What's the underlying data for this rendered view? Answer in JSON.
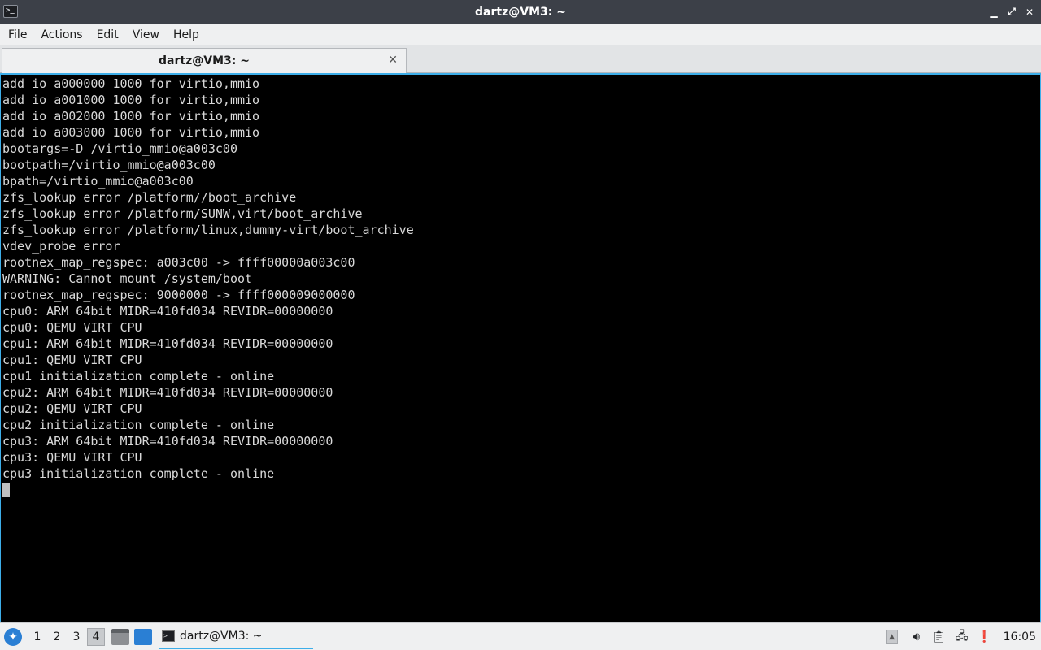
{
  "window": {
    "title": "dartz@VM3: ~",
    "app_icon": ">_",
    "controls": {
      "minimize": "▁",
      "maximize": "⤢",
      "close": "✕"
    }
  },
  "menu": {
    "items": [
      "File",
      "Actions",
      "Edit",
      "View",
      "Help"
    ]
  },
  "tabs": [
    {
      "label": "dartz@VM3: ~",
      "close": "✕"
    }
  ],
  "terminal": {
    "lines": [
      "add io a000000 1000 for virtio,mmio",
      "add io a001000 1000 for virtio,mmio",
      "add io a002000 1000 for virtio,mmio",
      "add io a003000 1000 for virtio,mmio",
      "bootargs=-D /virtio_mmio@a003c00",
      "bootpath=/virtio_mmio@a003c00",
      "bpath=/virtio_mmio@a003c00",
      "zfs_lookup error /platform//boot_archive",
      "zfs_lookup error /platform/SUNW,virt/boot_archive",
      "zfs_lookup error /platform/linux,dummy-virt/boot_archive",
      "vdev_probe error",
      "rootnex_map_regspec: a003c00 -> ffff00000a003c00",
      "WARNING: Cannot mount /system/boot",
      "rootnex_map_regspec: 9000000 -> ffff000009000000",
      "cpu0: ARM 64bit MIDR=410fd034 REVIDR=00000000",
      "cpu0: QEMU VIRT CPU",
      "cpu1: ARM 64bit MIDR=410fd034 REVIDR=00000000",
      "cpu1: QEMU VIRT CPU",
      "cpu1 initialization complete - online",
      "cpu2: ARM 64bit MIDR=410fd034 REVIDR=00000000",
      "cpu2: QEMU VIRT CPU",
      "cpu2 initialization complete - online",
      "cpu3: ARM 64bit MIDR=410fd034 REVIDR=00000000",
      "cpu3: QEMU VIRT CPU",
      "cpu3 initialization complete - online"
    ]
  },
  "taskbar": {
    "workspaces": [
      "1",
      "2",
      "3",
      "4"
    ],
    "active_workspace": "4",
    "task": {
      "label": "dartz@VM3: ~"
    },
    "tray": {
      "icons": [
        "volume-icon",
        "clipboard-icon",
        "network-icon",
        "updates-icon"
      ]
    },
    "clock": "16:05"
  },
  "colors": {
    "terminal_bg": "#000000",
    "terminal_fg": "#d9d9d9",
    "accent": "#3daee9",
    "titlebar": "#3c4048"
  }
}
